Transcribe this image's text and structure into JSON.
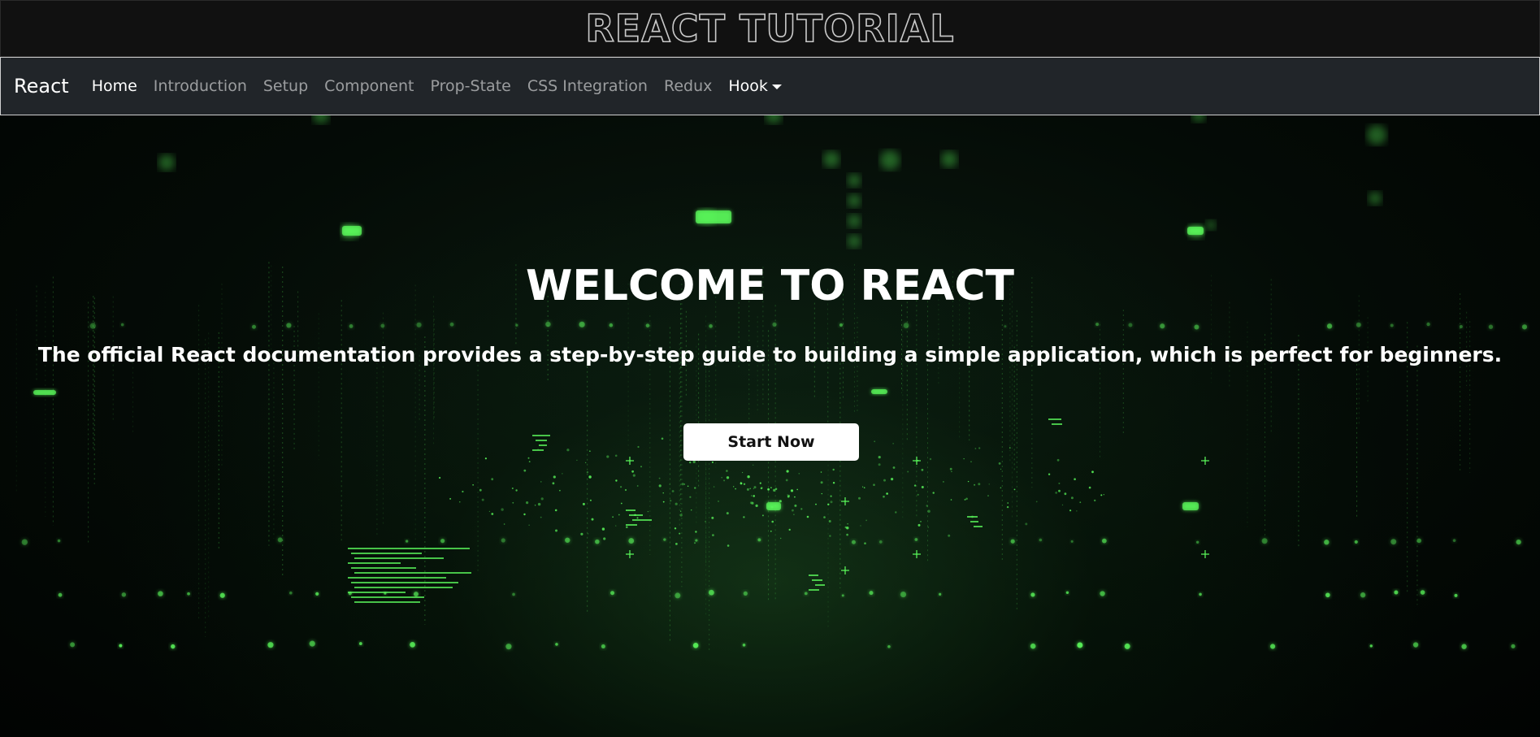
{
  "header": {
    "title": "REACT TUTORIAL"
  },
  "navbar": {
    "brand": "React",
    "items": [
      {
        "label": "Home",
        "active": true
      },
      {
        "label": "Introduction"
      },
      {
        "label": "Setup"
      },
      {
        "label": "Component"
      },
      {
        "label": "Prop-State"
      },
      {
        "label": "CSS Integration"
      },
      {
        "label": "Redux"
      },
      {
        "label": "Hook",
        "dropdown": true,
        "icon": "caret-down-icon"
      }
    ]
  },
  "hero": {
    "title": "WELCOME TO REACT",
    "subtitle": "The official React documentation provides a step-by-step guide to building a simple application, which is perfect for beginners.",
    "button_label": "Start Now"
  },
  "colors": {
    "navbar_bg": "#212529",
    "title_bar_bg": "#111111",
    "accent_green": "#5dff5d",
    "button_bg": "#ffffff"
  }
}
